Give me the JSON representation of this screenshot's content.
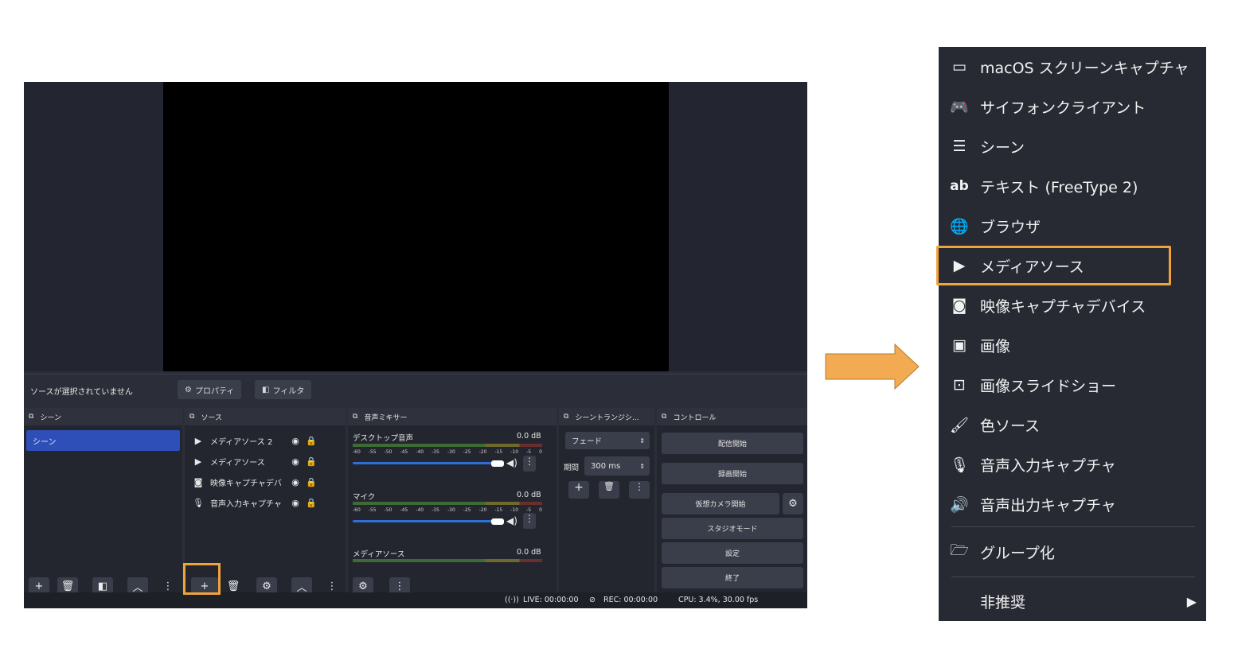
{
  "obs": {
    "no_source": "ソースが選択されていません",
    "properties_btn": "プロパティ",
    "filters_btn": "フィルタ",
    "docks": {
      "scenes": {
        "title": "シーン",
        "items": [
          "シーン"
        ]
      },
      "sources": {
        "title": "ソース",
        "items": [
          {
            "label": "メディアソース 2",
            "icon": "play-icon"
          },
          {
            "label": "メディアソース",
            "icon": "play-icon"
          },
          {
            "label": "映像キャプチャデバ",
            "icon": "camera-icon"
          },
          {
            "label": "音声入力キャプチャ",
            "icon": "mic-icon"
          }
        ]
      },
      "mixer": {
        "title": "音声ミキサー",
        "channels": [
          {
            "name": "デスクトップ音声",
            "db": "0.0 dB"
          },
          {
            "name": "マイク",
            "db": "0.0 dB"
          },
          {
            "name": "メディアソース",
            "db": "0.0 dB"
          }
        ],
        "ticks": [
          "-60",
          "-55",
          "-50",
          "-45",
          "-40",
          "-35",
          "-30",
          "-25",
          "-20",
          "-15",
          "-10",
          "-5",
          "0"
        ]
      },
      "transitions": {
        "title": "シーントランジシ...",
        "type": "フェード",
        "duration_label": "期間",
        "duration_value": "300 ms"
      },
      "controls": {
        "title": "コントロール",
        "buttons": [
          "配信開始",
          "録画開始",
          "仮想カメラ開始",
          "スタジオモード",
          "設定",
          "終了"
        ]
      }
    },
    "status": {
      "live": "LIVE: 00:00:00",
      "rec": "REC: 00:00:00",
      "cpu": "CPU: 3.4%, 30.00 fps"
    }
  },
  "menu": {
    "items": [
      {
        "label": "macOS スクリーンキャプチャ",
        "icon": "monitor-icon"
      },
      {
        "label": "サイフォンクライアント",
        "icon": "gamepad-icon"
      },
      {
        "label": "シーン",
        "icon": "list-icon"
      },
      {
        "label": "テキスト (FreeType 2)",
        "icon": "text-icon"
      },
      {
        "label": "ブラウザ",
        "icon": "globe-icon"
      },
      {
        "label": "メディアソース",
        "icon": "play-icon"
      },
      {
        "label": "映像キャプチャデバイス",
        "icon": "camera-icon"
      },
      {
        "label": "画像",
        "icon": "image-icon"
      },
      {
        "label": "画像スライドショー",
        "icon": "slideshow-icon"
      },
      {
        "label": "色ソース",
        "icon": "brush-icon"
      },
      {
        "label": "音声入力キャプチャ",
        "icon": "mic-icon"
      },
      {
        "label": "音声出力キャプチャ",
        "icon": "speaker-icon"
      }
    ],
    "group": {
      "label": "グループ化",
      "icon": "folder-icon"
    },
    "deprecated": {
      "label": "非推奨",
      "icon": "chevron-right-icon"
    }
  },
  "colors": {
    "accent_highlight": "#f0a33b",
    "scene_selected": "#2f4fb8",
    "menu_bg": "#272a33",
    "window_bg": "#2b2e38"
  }
}
